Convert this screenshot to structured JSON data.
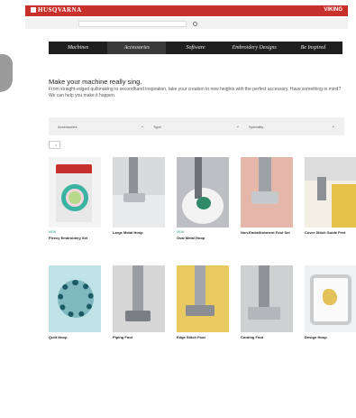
{
  "header": {
    "brand": "HUSQVARNA",
    "right_brand": "VIKING",
    "util_links": [
      "",
      "",
      "",
      "",
      ""
    ],
    "search_placeholder": ""
  },
  "nav": {
    "items": [
      {
        "label": "Machines"
      },
      {
        "label": "Accessories"
      },
      {
        "label": "Software"
      },
      {
        "label": "Embroidery Designs"
      },
      {
        "label": "Be Inspired"
      }
    ]
  },
  "headline": "Make your machine really sing.",
  "intro": "From straight-edged quiltmaking to secondhand inspiration, take your creation to new heights with the perfect accessory. Have something in mind? We can help you make it happen.",
  "filters": [
    {
      "label": "Accessories"
    },
    {
      "label": "Type"
    },
    {
      "label": "Specialty"
    }
  ],
  "chip": {
    "label": "",
    "remove": "×"
  },
  "products": [
    {
      "badge": "NEW",
      "name": "Fleecy Embroidery Set",
      "desc": "",
      "art": "t1"
    },
    {
      "badge": "",
      "name": "Large Metal Hoop",
      "desc": "",
      "art": "t2"
    },
    {
      "badge": "NEW",
      "name": "Oval Metal Hoop",
      "desc": "",
      "art": "t3"
    },
    {
      "badge": "",
      "name": "Non-Embellishment Foot Set",
      "desc": "",
      "art": "t4"
    },
    {
      "badge": "",
      "name": "Cover Stitch Guide Feet",
      "desc": "",
      "art": "t5"
    },
    {
      "badge": "",
      "name": "Quilt Hoop",
      "desc": "",
      "art": "t6"
    },
    {
      "badge": "",
      "name": "Piping Foot",
      "desc": "",
      "art": "t7"
    },
    {
      "badge": "",
      "name": "Edge Stitch Foot",
      "desc": "",
      "art": "t8"
    },
    {
      "badge": "",
      "name": "Cording Foot",
      "desc": "",
      "art": "t9"
    },
    {
      "badge": "",
      "name": "Design Hoop",
      "desc": "",
      "art": "t10"
    }
  ]
}
